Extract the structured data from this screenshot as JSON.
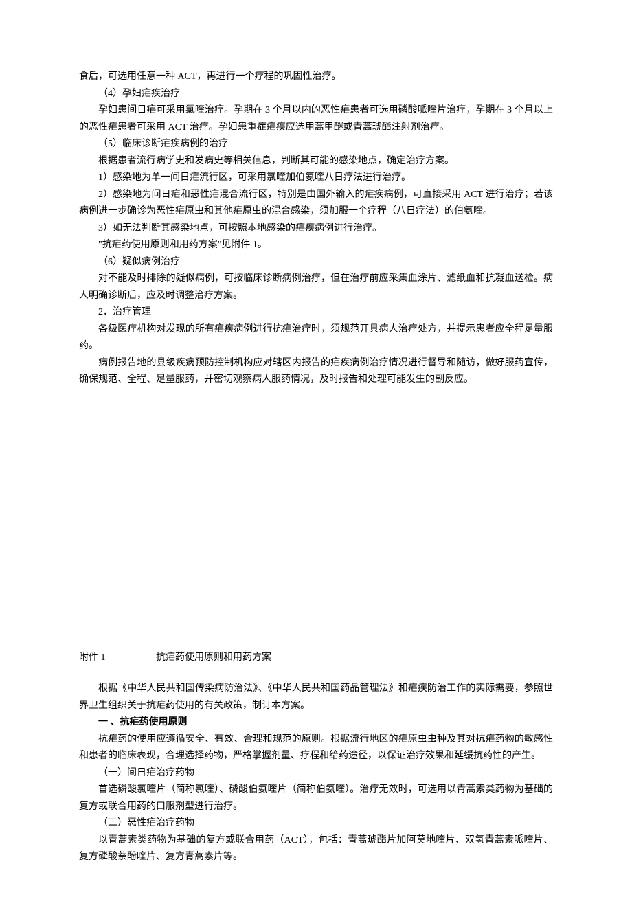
{
  "content": {
    "para1": "食后，可选用任意一种 ACT，再进行一个疗程的巩固性治疗。",
    "item4_title": "（4）孕妇疟疾治疗",
    "item4_body": "孕妇患间日疟可采用氯喹治疗。孕期在 3 个月以内的恶性疟患者可选用磷酸哌喹片治疗，孕期在 3 个月以上的恶性疟患者可采用 ACT 治疗。孕妇患重症疟疾应选用蒿甲醚或青蒿琥酯注射剂治疗。",
    "item5_title": "（5）临床诊断疟疾病例的治疗",
    "item5_body1": "根据患者流行病学史和发病史等相关信息，判断其可能的感染地点，确定治疗方案。",
    "item5_sub1": "1）感染地为单一间日疟流行区，可采用氯喹加伯氨喹八日疗法进行治疗。",
    "item5_sub2": "2）感染地为间日疟和恶性疟混合流行区，特别是由国外输入的疟疾病例，可直接采用 ACT 进行治疗；若该病例进一步确诊为恶性疟原虫和其他疟原虫的混合感染，须加服一个疗程（八日疗法）的伯氨喹。",
    "item5_sub3": "3）如无法判断其感染地点，可按照本地感染的疟疾病例进行治疗。",
    "item5_note": "\"抗疟药使用原则和用药方案\"见附件 1。",
    "item6_title": "（6）疑似病例治疗",
    "item6_body": "对不能及时排除的疑似病例，可按临床诊断病例治疗，但在治疗前应采集血涂片、滤纸血和抗凝血送检。病人明确诊断后，应及时调整治疗方案。",
    "section2_title": "2．治疗管理",
    "section2_body1": "各级医疗机构对发现的所有疟疾病例进行抗疟治疗时，须规范开具病人治疗处方，并提示患者应全程足量服药。",
    "section2_body2": "病例报告地的县级疾病预防控制机构应对辖区内报告的疟疾病例治疗情况进行督导和随访，做好服药宣传，确保规范、全程、足量服药，并密切观察病人服药情况，及时报告和处理可能发生的副反应。"
  },
  "attachment": {
    "label": "附件 1",
    "title": "抗疟药使用原则和用药方案",
    "intro": "根据《中华人民共和国传染病防治法》、《中华人民共和国药品管理法》和疟疾防治工作的实际需要，参照世界卫生组织关于抗疟药使用的有关政策，制订本方案。",
    "heading1": "一 、抗疟药使用原则",
    "heading1_body": "抗疟药的使用应遵循安全、有效、合理和规范的原则。根据流行地区的疟原虫虫种及其对抗疟药物的敏感性和患者的临床表现，合理选择药物，严格掌握剂量、疗程和给药途径，以保证治疗效果和延缓抗药性的产生。",
    "sub1_title": "（一）间日疟治疗药物",
    "sub1_body": "首选磷酸氯喹片（简称氯喹）、磷酸伯氨喹片（简称伯氨喹）。治疗无效时，可选用以青蒿素类药物为基础的复方或联合用药的口服剂型进行治疗。",
    "sub2_title": "（二）恶性疟治疗药物",
    "sub2_body": "以青蒿素类药物为基础的复方或联合用药（ACT），包括：青蒿琥酯片加阿莫地喹片、双氢青蒿素哌喹片、复方磷酸萘酚喹片、复方青蒿素片等。"
  }
}
